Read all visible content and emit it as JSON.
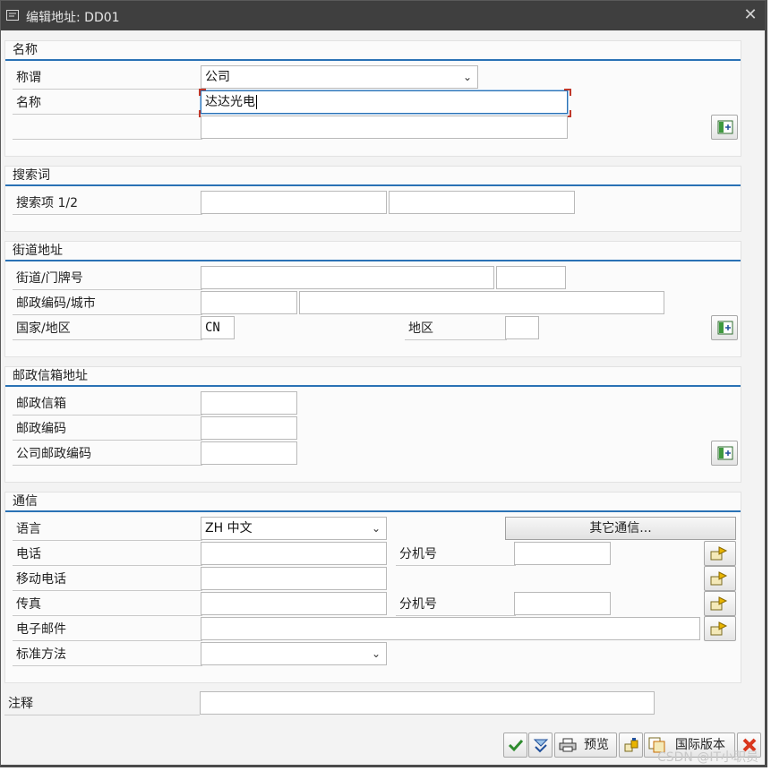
{
  "window": {
    "title": "编辑地址: DD01",
    "close_glyph": "✕"
  },
  "name_group": {
    "header": "名称",
    "salutation_label": "称谓",
    "salutation_value": "公司",
    "name_label": "名称",
    "name_value": "达达光电",
    "name2_value": ""
  },
  "search_group": {
    "header": "搜索词",
    "search_label": "搜索项 1/2",
    "term1": "",
    "term2": ""
  },
  "street_group": {
    "header": "街道地址",
    "street_label": "街道/门牌号",
    "postal_city_label": "邮政编码/城市",
    "country_label": "国家/地区",
    "country_value": "CN",
    "region_label": "地区"
  },
  "pobox_group": {
    "header": "邮政信箱地址",
    "pobox_label": "邮政信箱",
    "postal_code_label": "邮政编码",
    "company_postal_label": "公司邮政编码"
  },
  "comm_group": {
    "header": "通信",
    "language_label": "语言",
    "language_value": "ZH 中文",
    "other_comm_button": "其它通信...",
    "phone_label": "电话",
    "ext_label": "分机号",
    "mobile_label": "移动电话",
    "fax_label": "传真",
    "fax_ext_label": "分机号",
    "email_label": "电子邮件",
    "std_method_label": "标准方法",
    "std_method_value": ""
  },
  "notes": {
    "label": "注释",
    "value": ""
  },
  "toolbar": {
    "preview_label": "预览",
    "intl_label": "国际版本"
  },
  "watermark": "CSDN @IT小职员",
  "colors": {
    "accent_line": "#2a72b5",
    "titlebar": "#3f3f3f",
    "confirm": "#2e8b2e",
    "cancel": "#d9361c"
  }
}
